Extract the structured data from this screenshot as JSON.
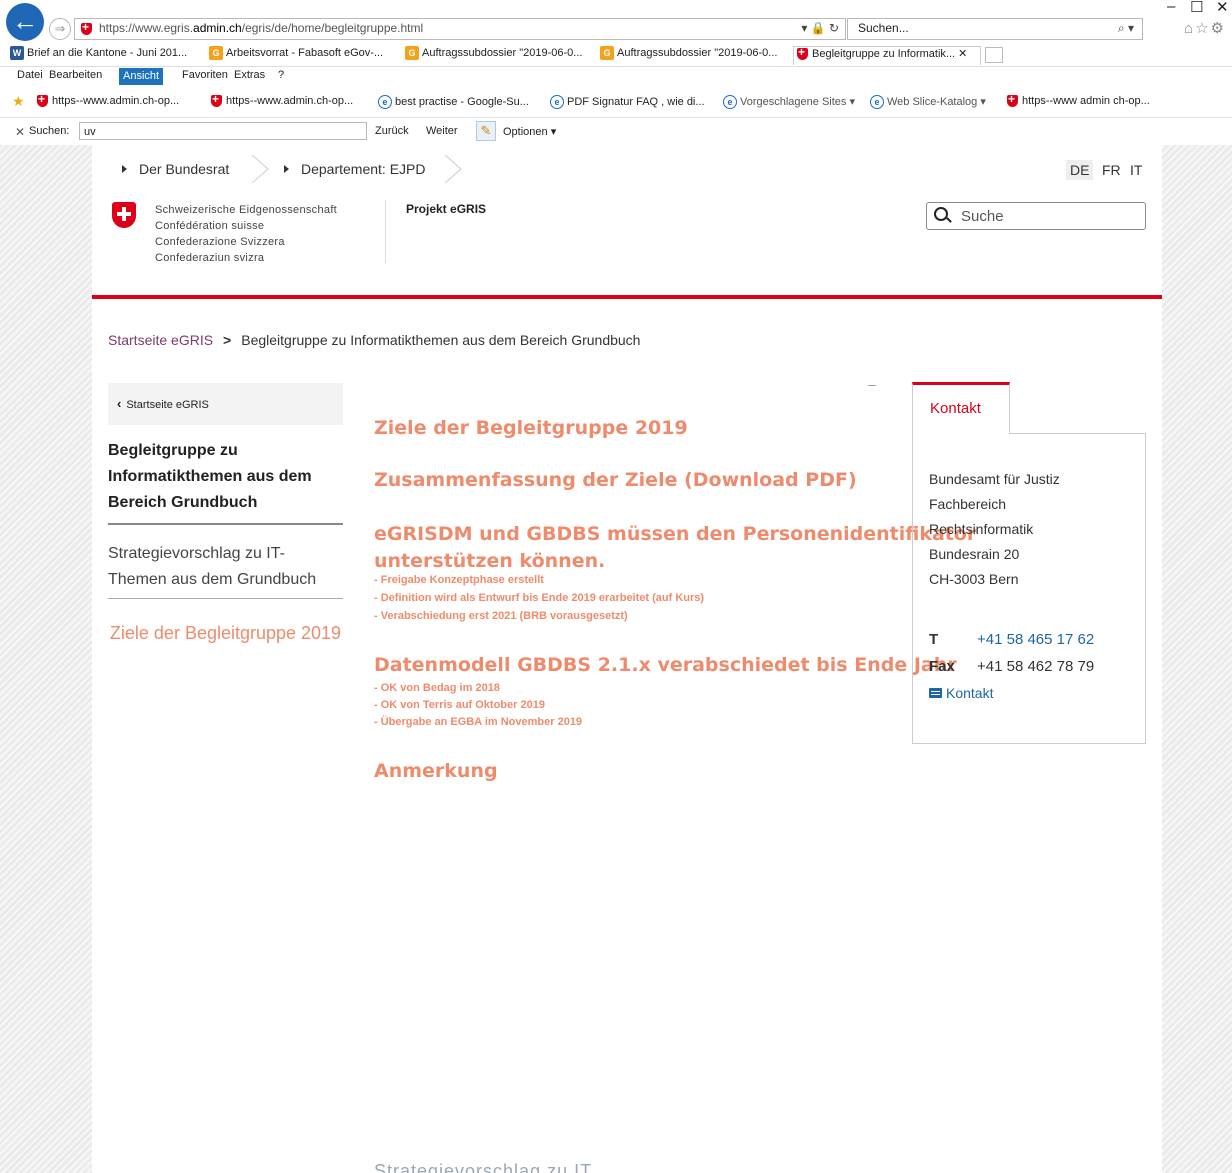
{
  "browser": {
    "url_prefix": "https://www.egris.",
    "url_domain": "admin.ch",
    "url_path": "/egris/de/home/begleitgruppe.html",
    "addr_icons": "▾ 🔒 ↻",
    "search_placeholder": "Suchen...",
    "search_icon": "⌕ ▾",
    "window_controls": {
      "minimize": "–",
      "maximize": "☐",
      "close": "✕"
    },
    "tabs": [
      {
        "label": "Brief an die Kantone - Juni 201...",
        "icon": "W"
      },
      {
        "label": "Arbeitsvorrat - Fabasoft eGov-...",
        "icon": "G"
      },
      {
        "label": "Auftragssubdossier \"2019-06-0...",
        "icon": "G"
      },
      {
        "label": "Auftragssubdossier \"2019-06-0...",
        "icon": "G"
      },
      {
        "label": "Begleitgruppe zu Informatik... ✕",
        "icon": "shield"
      }
    ],
    "menu": [
      "Datei",
      "Bearbeiten",
      "Ansicht",
      "Favoriten",
      "Extras",
      "?"
    ],
    "favorites": [
      "https--www.admin.ch-op...",
      "https--www.admin.ch-op...",
      "best practise - Google-Su...",
      "PDF Signatur FAQ , wie di...",
      "Vorgeschlagene Sites ▾",
      "Web Slice-Katalog ▾",
      "https--www admin ch-op..."
    ],
    "find": {
      "close": "✕",
      "label": "Suchen:",
      "value": "uv",
      "back": "Zurück",
      "forward": "Weiter",
      "options": "Optionen ▾"
    }
  },
  "page": {
    "top_breadcrumb": [
      "Der Bundesrat",
      "Departement: EJPD"
    ],
    "languages": [
      "DE",
      "FR",
      "IT"
    ],
    "logo_lines": [
      "Schweizerische Eidgenossenschaft",
      "Confédération suisse",
      "Confederazione Svizzera",
      "Confederaziun svizra"
    ],
    "project_title": "Projekt eGRIS",
    "search_placeholder": "Suche",
    "breadcrumb": {
      "home": "Startseite eGRIS",
      "separator": ">",
      "current": "Begleitgruppe zu Informatikthemen aus dem Bereich Grundbuch"
    },
    "nav": {
      "back_label": "Startseite eGRIS",
      "active": "Begleitgruppe zu Informatikthemen aus dem Bereich Grundbuch",
      "item": "Strategievorschlag zu IT-Themen aus dem Grundbuch",
      "sub": "Ziele der Begleitgruppe 2019"
    },
    "content": {
      "h1": "Ziele der Begleitgruppe 2019",
      "h2": "Zusammenfassung der Ziele (Download PDF)",
      "h3_line1": "eGRISDM und GBDBS müssen den Personenidentifikator",
      "h3_line2": "unterstützen können.",
      "h3_items": [
        "- Freigabe Konzeptphase erstellt",
        "- Definition wird als Entwurf bis Ende 2019 erarbeitet (auf Kurs)",
        "- Verabschiedung erst 2021 (BRB vorausgesetzt)"
      ],
      "h4": "Datenmodell GBDBS 2.1.x verabschiedet bis Ende Jahr",
      "h4_items": [
        "- OK von Bedag im 2018",
        "- OK von Terris auf Oktober 2019",
        "- Übergabe an EGBA im November 2019"
      ],
      "h5": "Anmerkung",
      "cutoff_text": "Strategievorschlag zu IT..."
    },
    "contact": {
      "tab": "Kontakt",
      "address": [
        "Bundesamt für Justiz",
        "Fachbereich",
        "Rechtsinformatik",
        "Bundesrain 20",
        "CH-3003 Bern"
      ],
      "tel_label": "T",
      "tel": "+41 58 465 17 62",
      "fax_label": "Fax",
      "fax": "+41 58 462 78 79",
      "link": "Kontakt"
    }
  },
  "colors": {
    "accent_red": "#dc0018",
    "heading_orange": "#ee8b6c",
    "link_blue": "#1f66a0",
    "breadcrumb_purple": "#7a3b6e"
  }
}
